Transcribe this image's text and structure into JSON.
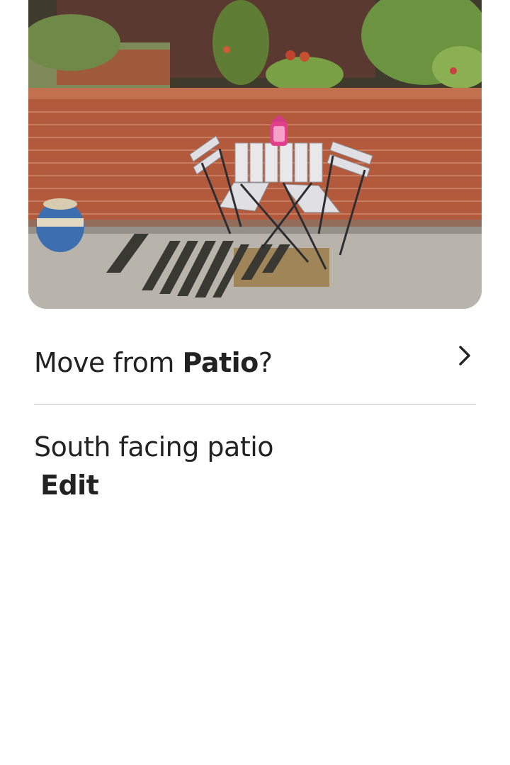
{
  "photo": {
    "description_icon": "patio-photo"
  },
  "move": {
    "prefix": "Move from ",
    "room": "Patio",
    "suffix": "?",
    "chevron_icon": "chevron-right-icon"
  },
  "caption": {
    "text": "South facing patio",
    "edit_label": "Edit"
  },
  "colors": {
    "text": "#222222",
    "divider": "#dddddd",
    "background": "#ffffff"
  }
}
